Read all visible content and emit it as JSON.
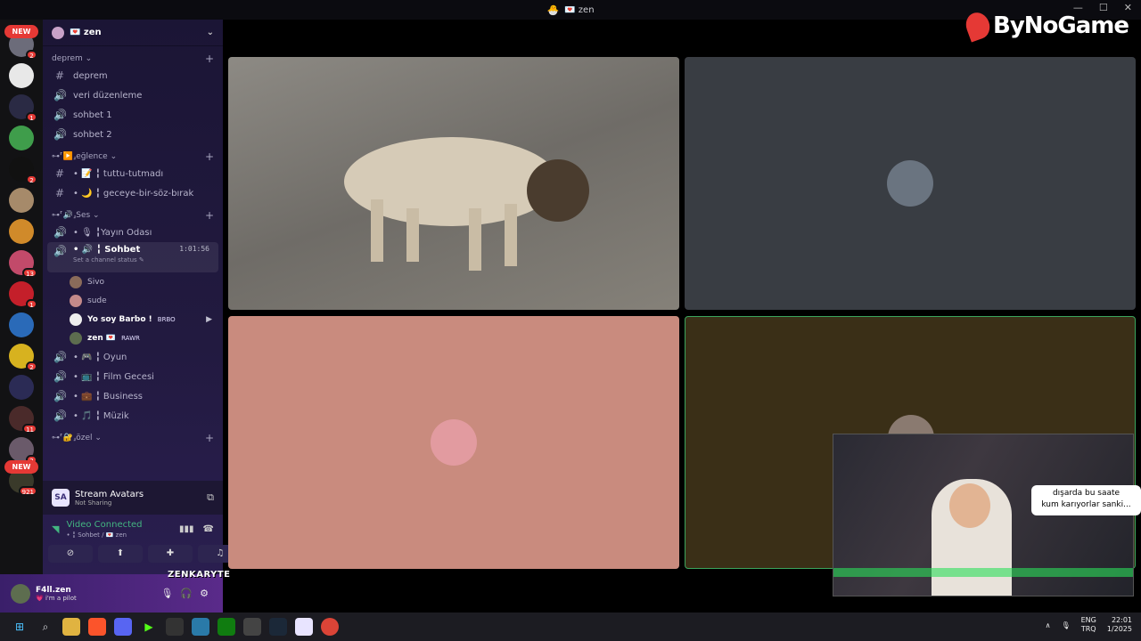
{
  "window": {
    "title": "zen",
    "title_emoji": "💌"
  },
  "logo": {
    "text": "ByNoGame"
  },
  "guild_badges": [
    "NEW",
    "2",
    "1",
    "2",
    "13",
    "1",
    "2",
    "11",
    "2",
    "921",
    "NEW"
  ],
  "server": {
    "name": "💌 zen"
  },
  "categories": {
    "deprem": "deprem",
    "eglence": "⊶⸢▶️⸥eğlence",
    "ses": "⊶⸢🔊⸥Ses",
    "ozel": "⊶⸢🔐⸥özel"
  },
  "channels": {
    "deprem": "deprem",
    "veri": "veri düzenleme",
    "sohbet1": "sohbet 1",
    "sohbet2": "sohbet 2",
    "tuttu": "• 📝 ╏ tuttu-tutmadı",
    "geceye": "• 🌙 ╏ geceye-bir-söz-bırak",
    "yayin": "• 🎙 ╏Yayın Odası",
    "sohbet": "• 🔊 ╏ Sohbet",
    "sohbet_time": "1:01:56",
    "sohbet_status": "Set a channel status ✎",
    "oyun": "• 🎮 ╏ Oyun",
    "film": "• 📺 ╏ Film Gecesi",
    "business": "• 💼 ╏ Business",
    "muzik": "• 🎵 ╏ Müzik"
  },
  "members": [
    {
      "name": "Sivo",
      "tag": "",
      "color": "#8a6b5a"
    },
    {
      "name": "sude",
      "tag": "",
      "color": "#c48a8a"
    },
    {
      "name": "Yo soy Barbo !",
      "tag": "BRBO",
      "color": "#eeeeee"
    },
    {
      "name": "zen 💌",
      "tag": "RAWR",
      "color": "#5d6d4f"
    }
  ],
  "stream_panel": {
    "title": "Stream Avatars",
    "sub": "Not Sharing",
    "icon": "SA"
  },
  "video_panel": {
    "status": "Video Connected",
    "sub": "• ╏ Sohbet / 💌 zen"
  },
  "user": {
    "name": "F4ll.zen",
    "status": "💗 i'm a pilot"
  },
  "streamer": {
    "name": "ZENKARYTE"
  },
  "speech_bubble": {
    "line1": "dışarda bu saate",
    "line2": "kum karıyorlar sanki..."
  },
  "tray": {
    "lang1": "ENG",
    "lang2": "TRQ",
    "time": "22:01",
    "date": "1/2025"
  },
  "colors": {
    "accent_green": "#3ba55d",
    "badge_red": "#e53935"
  }
}
